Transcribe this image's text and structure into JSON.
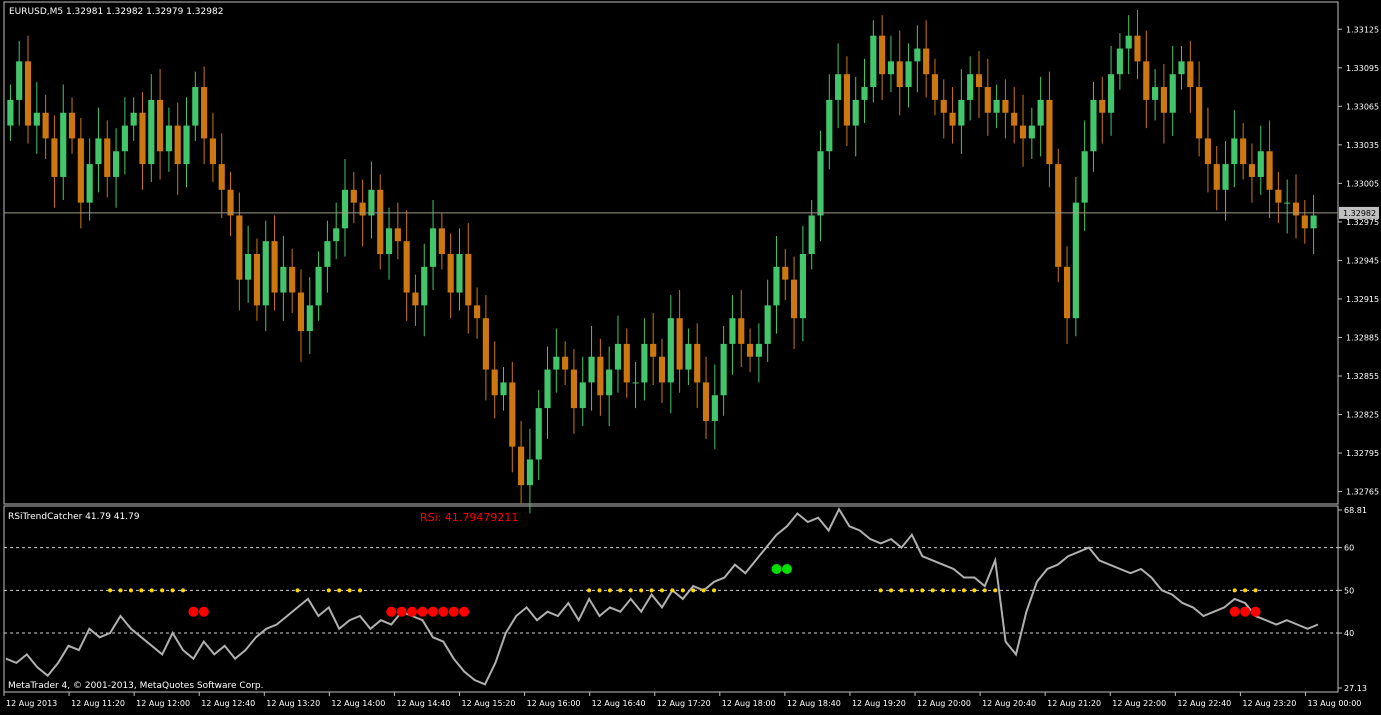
{
  "window": {
    "symbol_header": "EURUSD,M5  1.32981 1.32982 1.32979 1.32982",
    "indicator_header": "RSiTrendCatcher 41.79 41.79",
    "rsi_readout": "RSi: 41.79479211",
    "copyright": "MetaTrader 4, © 2001-2013, MetaQuotes Software Corp."
  },
  "colors": {
    "background": "#000000",
    "grid_frame": "#c0c0c0",
    "bull": "#43c66b",
    "bear": "#cc7711",
    "rsi_line": "#b0b0b0",
    "dot_neutral": "#ffd700",
    "dot_sell": "#ff0000",
    "dot_buy": "#00e000",
    "rsi_text": "#ff0000"
  },
  "chart_data": [
    {
      "type": "candlestick",
      "title": "EURUSD,M5",
      "ylim": [
        1.3276,
        1.3314
      ],
      "price_ticks": [
        "1.33125",
        "1.33095",
        "1.33065",
        "1.33035",
        "1.33005",
        "1.32975",
        "1.32945",
        "1.32915",
        "1.32885",
        "1.32855",
        "1.32825",
        "1.32795",
        "1.32765"
      ],
      "current_price": "1.32982",
      "time_labels": [
        "12 Aug 2013",
        "12 Aug 11:20",
        "12 Aug 12:00",
        "12 Aug 12:40",
        "12 Aug 13:20",
        "12 Aug 14:00",
        "12 Aug 14:40",
        "12 Aug 15:20",
        "12 Aug 16:00",
        "12 Aug 16:40",
        "12 Aug 17:20",
        "12 Aug 18:00",
        "12 Aug 18:40",
        "12 Aug 19:20",
        "12 Aug 20:00",
        "12 Aug 20:40",
        "12 Aug 21:20",
        "12 Aug 22:00",
        "12 Aug 22:40",
        "12 Aug 23:20",
        "13 Aug 00:00"
      ],
      "close": [
        1.3307,
        1.331,
        1.3305,
        1.3306,
        1.3304,
        1.3301,
        1.3306,
        1.3304,
        1.3299,
        1.3302,
        1.3304,
        1.3301,
        1.3303,
        1.3305,
        1.3306,
        1.3302,
        1.3307,
        1.3303,
        1.3305,
        1.3302,
        1.3305,
        1.3308,
        1.3304,
        1.3302,
        1.33,
        1.3298,
        1.3293,
        1.3295,
        1.3291,
        1.3296,
        1.3292,
        1.3294,
        1.3292,
        1.3289,
        1.3291,
        1.3294,
        1.3296,
        1.3297,
        1.33,
        1.3299,
        1.3298,
        1.33,
        1.3295,
        1.3297,
        1.3296,
        1.3292,
        1.3291,
        1.3294,
        1.3297,
        1.3295,
        1.3292,
        1.3295,
        1.3291,
        1.329,
        1.3286,
        1.3284,
        1.3285,
        1.328,
        1.3277,
        1.3279,
        1.3283,
        1.3286,
        1.3287,
        1.3286,
        1.3283,
        1.3285,
        1.3287,
        1.3284,
        1.3286,
        1.3288,
        1.3285,
        1.3285,
        1.3288,
        1.3287,
        1.3285,
        1.329,
        1.3286,
        1.3288,
        1.3285,
        1.3282,
        1.3284,
        1.3288,
        1.329,
        1.3288,
        1.3287,
        1.3288,
        1.3291,
        1.3294,
        1.3293,
        1.329,
        1.3295,
        1.3298,
        1.3303,
        1.3307,
        1.3309,
        1.3305,
        1.3307,
        1.3308,
        1.3312,
        1.3309,
        1.331,
        1.3308,
        1.331,
        1.3311,
        1.3309,
        1.3307,
        1.3306,
        1.3305,
        1.3307,
        1.3309,
        1.3308,
        1.3306,
        1.3307,
        1.3306,
        1.3305,
        1.3304,
        1.3305,
        1.3307,
        1.3302,
        1.3294,
        1.329,
        1.3299,
        1.3303,
        1.3307,
        1.3306,
        1.3309,
        1.3311,
        1.3312,
        1.331,
        1.3307,
        1.3308,
        1.3306,
        1.3309,
        1.331,
        1.3308,
        1.3304,
        1.3302,
        1.33,
        1.3302,
        1.3304,
        1.3302,
        1.3301,
        1.3303,
        1.33,
        1.3299,
        1.3299,
        1.3298,
        1.3297,
        1.3298
      ]
    },
    {
      "type": "line",
      "title": "RSiTrendCatcher",
      "ylim": [
        27.13,
        68.81
      ],
      "y_ticks": [
        "68.81",
        "60",
        "50",
        "40",
        "27.13"
      ],
      "levels": [
        60,
        50,
        40
      ],
      "rsi": [
        34,
        33,
        35,
        32,
        30,
        33,
        37,
        36,
        41,
        39,
        40,
        44,
        41,
        39,
        37,
        35,
        40,
        36,
        34,
        38,
        35,
        37,
        34,
        36,
        39,
        41,
        42,
        44,
        46,
        48,
        44,
        46,
        41,
        43,
        44,
        41,
        43,
        42,
        45,
        44,
        43,
        39,
        38,
        34,
        31,
        29,
        28,
        33,
        40,
        44,
        46,
        43,
        45,
        44,
        47,
        43,
        48,
        44,
        46,
        45,
        48,
        45,
        49,
        46,
        50,
        48,
        51,
        50,
        52,
        53,
        56,
        54,
        57,
        60,
        63,
        65,
        68,
        66,
        67,
        64,
        69,
        65,
        64,
        62,
        61,
        62,
        60,
        63,
        58,
        57,
        56,
        55,
        53,
        53,
        51,
        57,
        38,
        35,
        45,
        52,
        55,
        56,
        58,
        59,
        60,
        57,
        56,
        55,
        54,
        55,
        53,
        50,
        49,
        47,
        46,
        44,
        45,
        46,
        48,
        47,
        44,
        43,
        42,
        43,
        42,
        41,
        42
      ]
    }
  ],
  "signals": {
    "neutral": [
      [
        10,
        50
      ],
      [
        11,
        50
      ],
      [
        12,
        50
      ],
      [
        13,
        50
      ],
      [
        14,
        50
      ],
      [
        15,
        50
      ],
      [
        16,
        50
      ],
      [
        17,
        50
      ],
      [
        28,
        50
      ],
      [
        31,
        50
      ],
      [
        32,
        50
      ],
      [
        33,
        50
      ],
      [
        34,
        50
      ],
      [
        56,
        50
      ],
      [
        57,
        50
      ],
      [
        58,
        50
      ],
      [
        59,
        50
      ],
      [
        60,
        50
      ],
      [
        61,
        50
      ],
      [
        62,
        50
      ],
      [
        63,
        50
      ],
      [
        64,
        50
      ],
      [
        65,
        50
      ],
      [
        66,
        50
      ],
      [
        67,
        50
      ],
      [
        68,
        50
      ],
      [
        84,
        50
      ],
      [
        85,
        50
      ],
      [
        86,
        50
      ],
      [
        87,
        50
      ],
      [
        88,
        50
      ],
      [
        89,
        50
      ],
      [
        90,
        50
      ],
      [
        91,
        50
      ],
      [
        92,
        50
      ],
      [
        93,
        50
      ],
      [
        94,
        50
      ],
      [
        95,
        50
      ],
      [
        118,
        50
      ],
      [
        119,
        50
      ],
      [
        120,
        50
      ]
    ],
    "sell": [
      [
        18,
        45
      ],
      [
        19,
        45
      ],
      [
        37,
        45
      ],
      [
        38,
        45
      ],
      [
        39,
        45
      ],
      [
        40,
        45
      ],
      [
        41,
        45
      ],
      [
        42,
        45
      ],
      [
        43,
        45
      ],
      [
        44,
        45
      ],
      [
        118,
        45
      ],
      [
        119,
        45
      ],
      [
        120,
        45
      ]
    ],
    "buy": [
      [
        74,
        55
      ],
      [
        75,
        55
      ]
    ]
  }
}
